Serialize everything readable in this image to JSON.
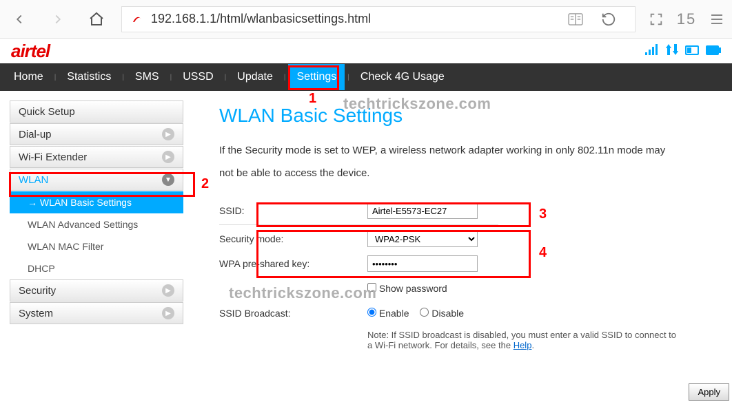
{
  "browser": {
    "url": "192.168.1.1/html/wlanbasicsettings.html",
    "tab_count": "15"
  },
  "brand": "airtel",
  "nav": {
    "items": [
      "Home",
      "Statistics",
      "SMS",
      "USSD",
      "Update",
      "Settings",
      "Check 4G Usage"
    ],
    "active": "Settings"
  },
  "sidebar": {
    "items": [
      {
        "label": "Quick Setup"
      },
      {
        "label": "Dial-up"
      },
      {
        "label": "Wi-Fi Extender"
      },
      {
        "label": "WLAN",
        "expanded": true,
        "subs": [
          {
            "label": "WLAN Basic Settings",
            "active": true
          },
          {
            "label": "WLAN Advanced Settings"
          },
          {
            "label": "WLAN MAC Filter"
          },
          {
            "label": "DHCP"
          }
        ]
      },
      {
        "label": "Security"
      },
      {
        "label": "System"
      }
    ]
  },
  "main": {
    "title": "WLAN Basic Settings",
    "intro": "If the Security mode is set to WEP, a wireless network adapter working in only 802.11n mode may not be able to access the device.",
    "ssid_label": "SSID:",
    "ssid_value": "Airtel-E5573-EC27",
    "secmode_label": "Security mode:",
    "secmode_value": "WPA2-PSK",
    "wpakey_label": "WPA pre-shared key:",
    "wpakey_value": "••••••••",
    "showpw_label": "Show password",
    "ssidbc_label": "SSID Broadcast:",
    "enable_label": "Enable",
    "disable_label": "Disable",
    "note_prefix": "Note: If SSID broadcast is disabled, you must enter a valid SSID to connect to a Wi-Fi network. For details, see the ",
    "note_link": "Help",
    "note_suffix": ".",
    "apply_label": "Apply"
  },
  "annotations": {
    "n1": "1",
    "n2": "2",
    "n3": "3",
    "n4": "4"
  },
  "watermark": "techtrickszone.com"
}
